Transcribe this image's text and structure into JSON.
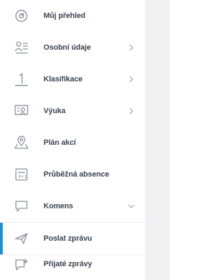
{
  "menu": {
    "items": [
      {
        "label": "Můj přehled",
        "icon": "dashboard-icon",
        "has_chevron": false
      },
      {
        "label": "Osobní údaje",
        "icon": "personal-data-icon",
        "has_chevron": true,
        "chevron": "chevron-right"
      },
      {
        "label": "Klasifikace",
        "icon": "grades-icon",
        "has_chevron": true,
        "chevron": "chevron-right"
      },
      {
        "label": "Výuka",
        "icon": "teaching-icon",
        "has_chevron": true,
        "chevron": "chevron-right"
      },
      {
        "label": "Plán akcí",
        "icon": "map-pin-icon",
        "has_chevron": false
      },
      {
        "label": "Průběžná absence",
        "icon": "absence-icon",
        "has_chevron": false
      },
      {
        "label": "Komens",
        "icon": "chat-icon",
        "has_chevron": true,
        "chevron": "chevron-down"
      },
      {
        "label": "Poslat zprávu",
        "icon": "send-message-icon",
        "has_chevron": false,
        "active": true
      },
      {
        "label": "Přijaté zprávy",
        "icon": "inbox-message-icon",
        "has_chevron": false
      }
    ]
  },
  "colors": {
    "accent": "#1e8fd6",
    "text": "#3a4350",
    "icon": "#8a9099",
    "background_strip": "#f1f1f3"
  }
}
